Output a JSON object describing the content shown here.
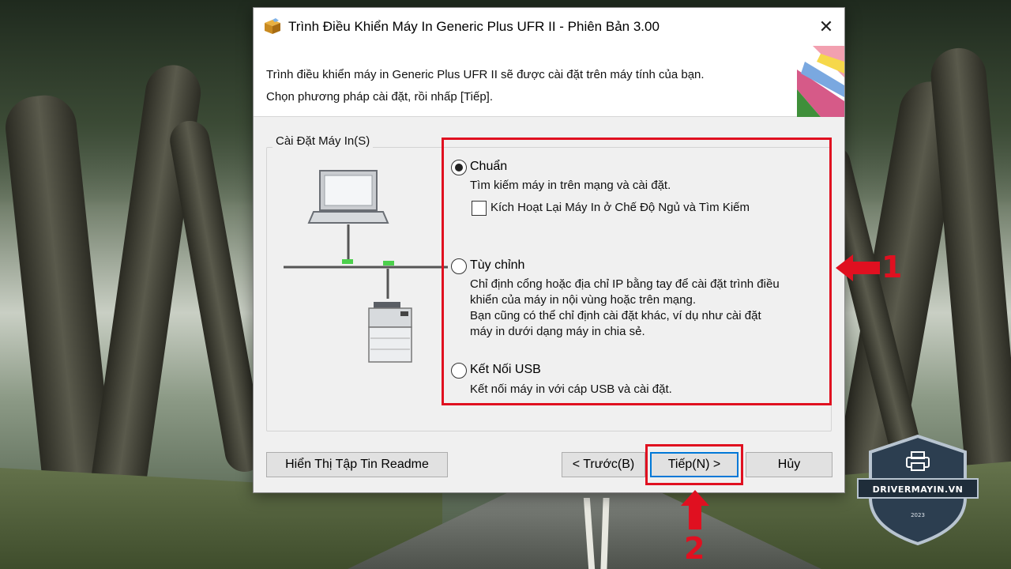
{
  "window": {
    "title": "Trình Điều Khiển Máy In Generic Plus UFR II - Phiên Bản 3.00",
    "close_glyph": "✕"
  },
  "header": {
    "line1": "Trình điều khiển máy in Generic Plus UFR II sẽ được cài đặt trên máy tính của bạn.",
    "line2": "Chọn phương pháp cài đặt, rồi nhấp [Tiếp]."
  },
  "group": {
    "label": "Cài Đặt Máy In(S)",
    "options": [
      {
        "title": "Chuẩn",
        "selected": true,
        "desc": [
          "Tìm kiếm máy in trên mạng và cài đặt."
        ],
        "checkbox_label": "Kích Hoạt Lại Máy In ở Chế Độ Ngủ và Tìm Kiếm",
        "checkbox_checked": false
      },
      {
        "title": "Tùy chỉnh",
        "selected": false,
        "desc": [
          "Chỉ định cổng hoặc địa chỉ IP bằng tay để cài đặt trình điều",
          "khiển của máy in nội vùng hoặc trên mạng.",
          "Bạn cũng có thể chỉ định cài đặt khác, ví dụ như cài đặt",
          "máy in dưới dạng máy in chia sẻ."
        ]
      },
      {
        "title": "Kết Nối USB",
        "selected": false,
        "desc": [
          "Kết nối máy in với cáp USB và cài đặt."
        ]
      }
    ]
  },
  "buttons": {
    "readme": "Hiển Thị Tập Tin Readme",
    "back": "< Trước(B)",
    "next": "Tiếp(N) >",
    "cancel": "Hủy"
  },
  "annotations": {
    "step1": "1",
    "step2": "2",
    "highlight_color": "#e01020"
  },
  "watermark": {
    "name": "DRIVERMAYIN.VN",
    "year": "2023",
    "icon": "printer-icon"
  }
}
